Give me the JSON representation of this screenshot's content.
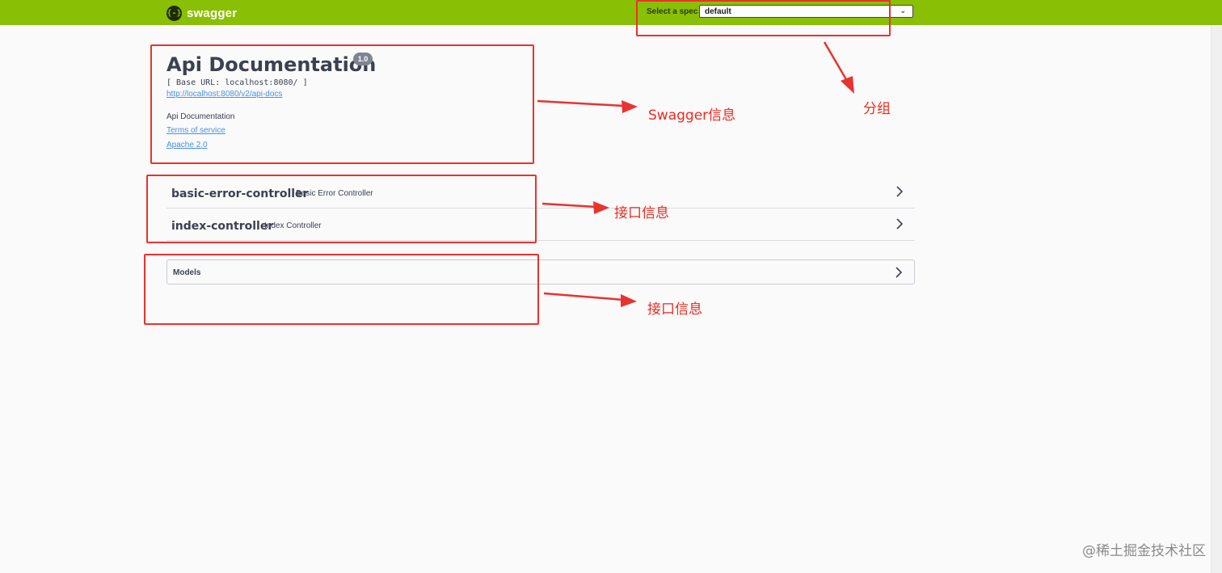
{
  "topbar": {
    "logo_text": "swagger",
    "logo_icon": "{-}",
    "spec_label": "Select a spec",
    "spec_selected": "default"
  },
  "info": {
    "title": "Api Documentation",
    "version": "1.0",
    "base_url": "[ Base URL: localhost:8080/ ]",
    "docs_link": "http://localhost:8080/v2/api-docs",
    "description": "Api Documentation",
    "terms_link": "Terms of service",
    "license_link": "Apache 2.0"
  },
  "tags": [
    {
      "name": "basic-error-controller",
      "description": "Basic Error Controller"
    },
    {
      "name": "index-controller",
      "description": "Index Controller"
    }
  ],
  "models": {
    "label": "Models"
  },
  "annotations": {
    "swagger_info": "Swagger信息",
    "group": "分组",
    "api_info_1": "接口信息",
    "api_info_2": "接口信息"
  },
  "watermark": "@稀土掘金技术社区",
  "colors": {
    "topbar": "#89bf04",
    "annotation": "#e8332f",
    "link": "#4990e2"
  }
}
